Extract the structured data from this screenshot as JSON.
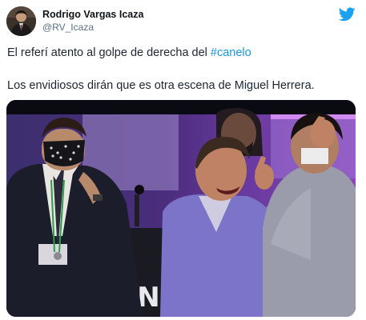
{
  "tweet": {
    "author": {
      "name": "Rodrigo Vargas Icaza",
      "handle": "@RV_Icaza",
      "avatar_icon": "profile-photo"
    },
    "brand_icon": "twitter-bird-icon",
    "brand_color": "#1da1f2",
    "text": {
      "line1_prefix": "El referí atento al golpe de derecha del ",
      "line1_hashtag": "#canelo",
      "line2": "Los envidiosos dirán que es otra escena de Miguel Herrera."
    },
    "hashtag_color": "#1b95e0",
    "media": {
      "type": "photo",
      "background_sign_partial": "DNS"
    }
  }
}
